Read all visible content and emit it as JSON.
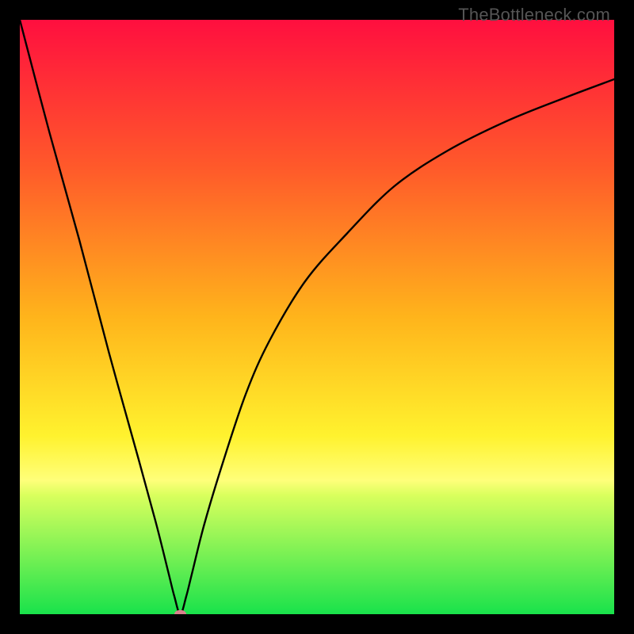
{
  "watermark": "TheBottleneck.com",
  "colors": {
    "top": "#ff0f3f",
    "q1": "#ff5a2a",
    "mid": "#ffb41b",
    "q3": "#fff22e",
    "band_top": "#ffff7a",
    "band_bot": "#d9ff5d",
    "bottom": "#19e24b",
    "line": "#000000",
    "marker": "#d9828c"
  },
  "chart_data": {
    "type": "line",
    "title": "",
    "xlabel": "",
    "ylabel": "",
    "xlim": [
      0,
      100
    ],
    "ylim": [
      0,
      100
    ],
    "x_min_point": 27,
    "series": [
      {
        "name": "curve",
        "x": [
          0,
          5,
          10,
          15,
          20,
          23,
          25,
          26,
          27,
          28,
          29,
          31,
          34,
          38,
          42,
          48,
          55,
          63,
          72,
          82,
          92,
          100
        ],
        "values": [
          100,
          81,
          63,
          44,
          26,
          15,
          7,
          3,
          0,
          3,
          7,
          15,
          25,
          37,
          46,
          56,
          64,
          72,
          78,
          83,
          87,
          90
        ]
      }
    ],
    "marker": {
      "x": 27,
      "y": 0,
      "rx": 1.0,
      "ry": 0.7
    },
    "bands": [
      {
        "y": 77.5,
        "color_ref": "band_top"
      },
      {
        "y": 80.0,
        "color_ref": "band_bot"
      }
    ]
  }
}
